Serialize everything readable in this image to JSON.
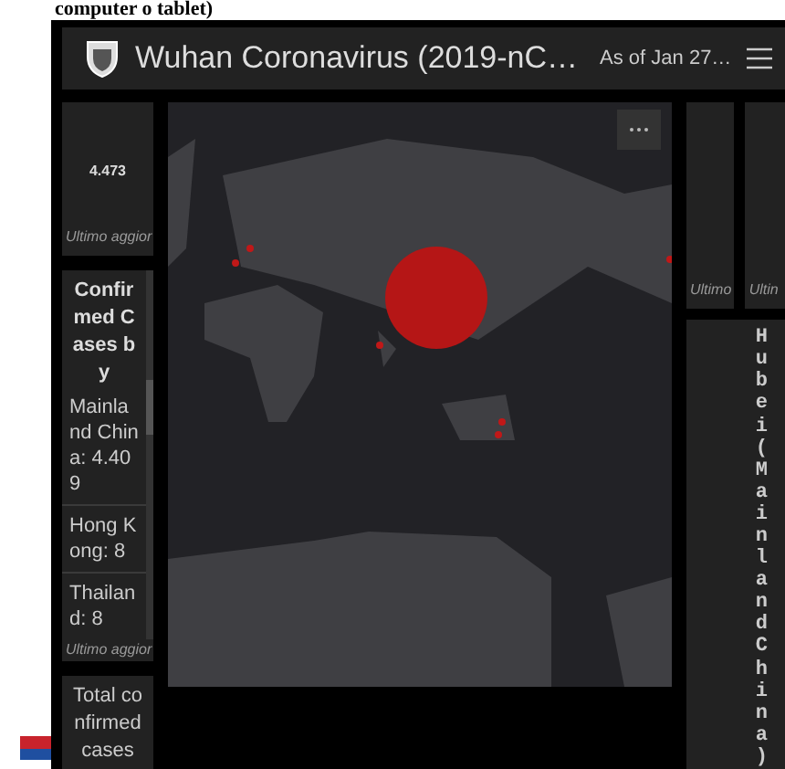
{
  "caption": "computer o tablet)",
  "header": {
    "title": "Wuhan Coronavirus (2019-nC…",
    "date": "As of Jan 27…"
  },
  "left_panels": [
    {
      "kind": "total",
      "value": "4.473",
      "footer": "Ultimo aggior"
    },
    {
      "kind": "list",
      "heading": "Confirmed Cases by",
      "items": [
        "Mainland China: 4.409",
        "Hong Kong: 8",
        "Thailand: 8"
      ],
      "footer": "Ultimo aggior"
    },
    {
      "kind": "label",
      "heading": "Total confirmed cases"
    }
  ],
  "right_panels": [
    {
      "footer": "Ultimo"
    },
    {
      "footer": "Ultin"
    }
  ],
  "right_list": {
    "heading": "Hubei(MainlandChina)"
  }
}
